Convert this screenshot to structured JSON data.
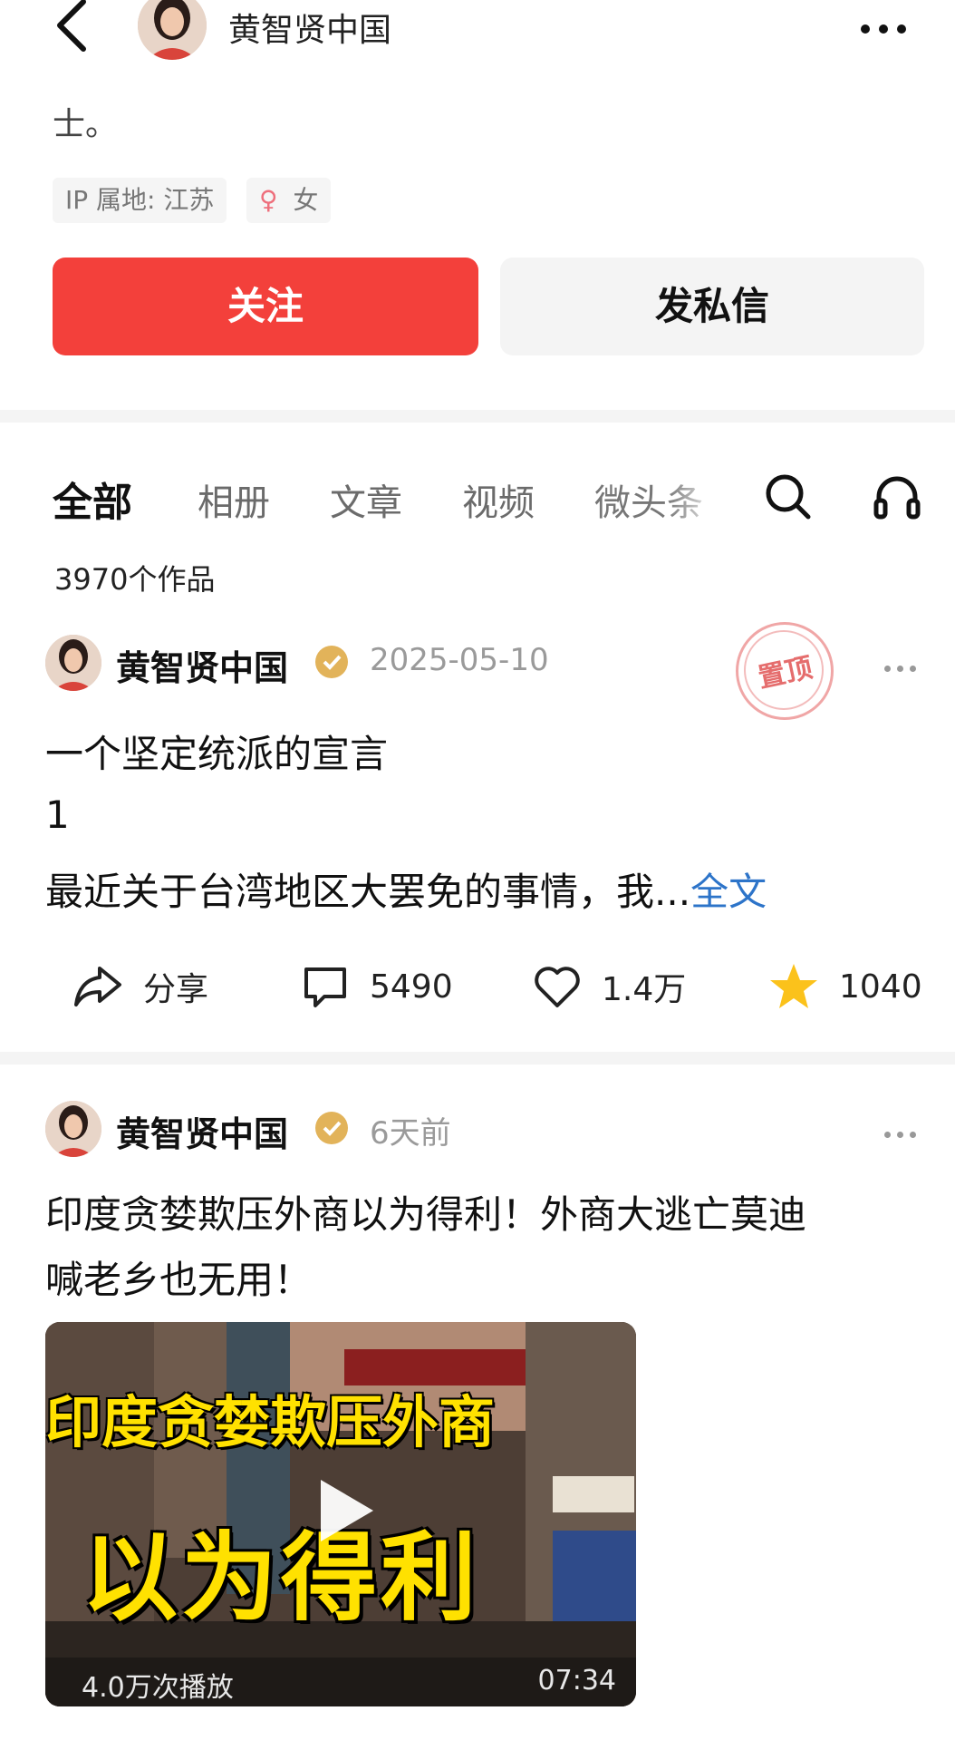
{
  "header": {
    "title": "黄智贤中国",
    "back_icon": "chevron-left-icon",
    "more_icon": "more-horizontal-icon"
  },
  "profile": {
    "bio_tail": "士。",
    "ip_tag": "IP 属地: 江苏",
    "gender_symbol": "♀",
    "gender_label": "女",
    "follow_label": "关注",
    "message_label": "发私信"
  },
  "tabs": {
    "items": [
      "全部",
      "相册",
      "文章",
      "视频",
      "微头条"
    ],
    "active": "全部",
    "search_icon": "search-icon",
    "audio_icon": "headphones-icon"
  },
  "works_count": "3970个作品",
  "posts": [
    {
      "author": "黄智贤中国",
      "time": "2025-05-10",
      "pinned_stamp": "置顶",
      "title": "一个坚定统派的宣言",
      "line2": "1",
      "excerpt": "最近关于台湾地区大罢免的事情，我...",
      "more_link": "全文",
      "actions": {
        "share_label": "分享",
        "comments": "5490",
        "likes": "1.4万",
        "favorites": "1040"
      }
    },
    {
      "author": "黄智贤中国",
      "time": "6天前",
      "title_line1": "印度贪婪欺压外商以为得利！外商大逃亡莫迪",
      "title_line2": "喊老乡也无用！",
      "video": {
        "caption_line1": "印度贪婪欺压外商",
        "caption_line2": "以为得利",
        "views": "4.0万次播放",
        "duration": "07:34"
      }
    }
  ],
  "colors": {
    "follow_red": "#f3403b",
    "star_yellow": "#fbc21b",
    "link_blue": "#2d74c9",
    "verified_gold": "#e2b35a"
  }
}
